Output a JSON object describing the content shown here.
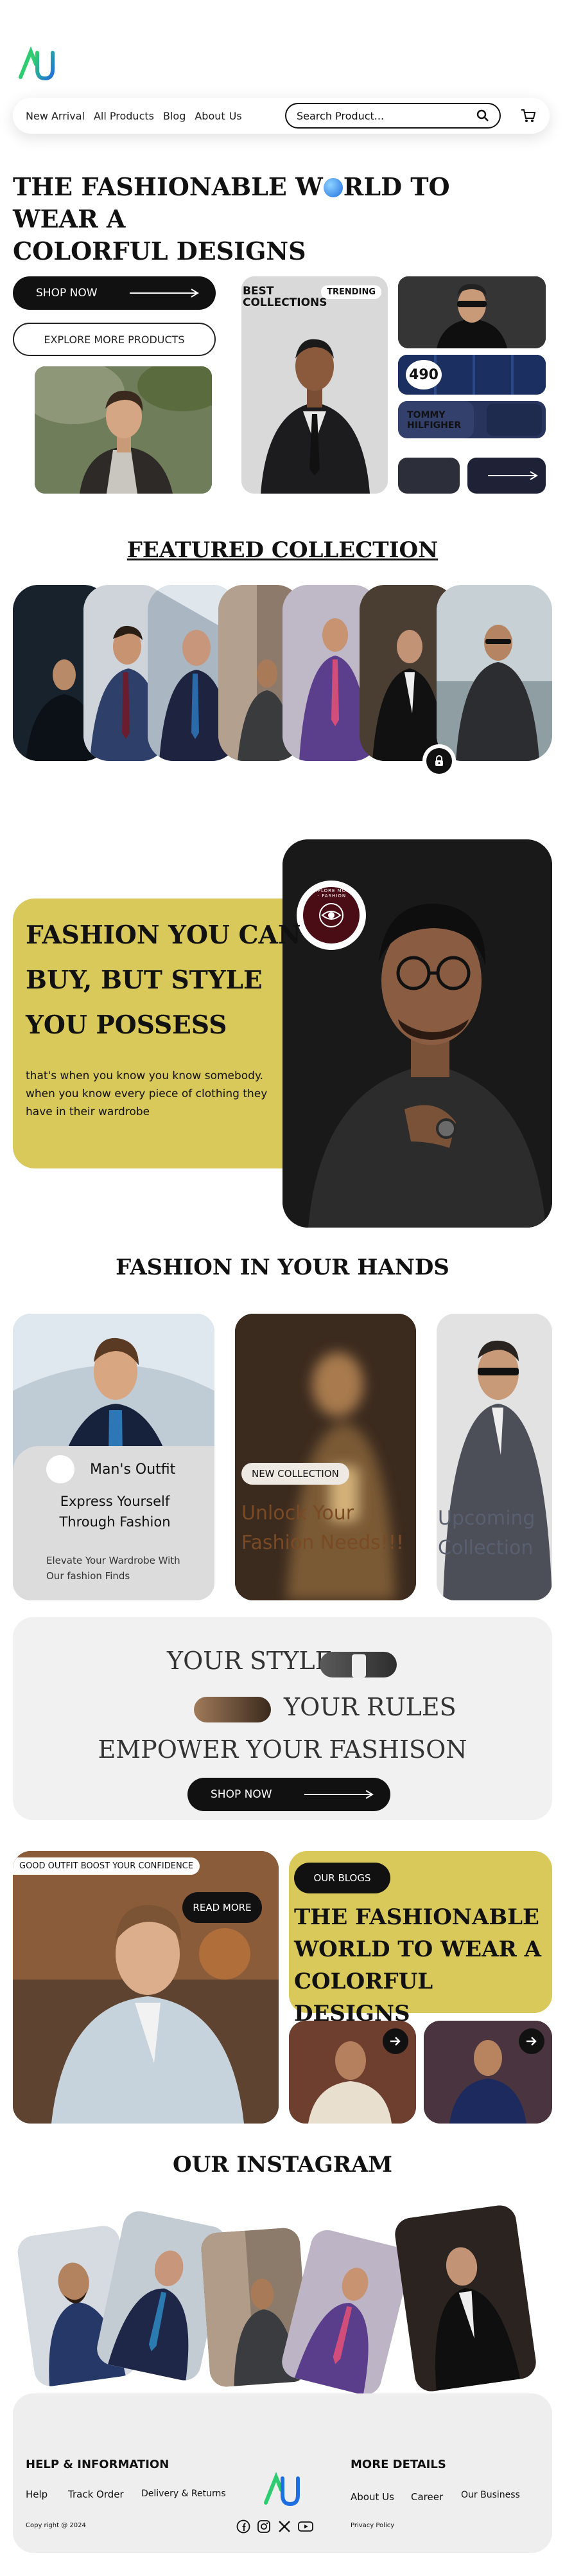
{
  "header": {
    "nav": [
      "New Arrival",
      "All Products",
      "Blog",
      "About",
      "Us"
    ],
    "search_placeholder": "Search Product..."
  },
  "hero": {
    "title_line1_a": "THE FASHIONABLE W",
    "title_line1_b": "RLD TO WEAR A",
    "title_line2": "COLORFUL DESIGNS",
    "shop_now": "SHOP NOW",
    "explore": "EXPLORE MORE PRODUCTS",
    "best_collections": "BEST COLLECTIONS",
    "trending": "TRENDING",
    "price": "490",
    "brand_tommy": "TOMMY HILFIGHER"
  },
  "featured": {
    "title": "FEATURED  COLLECTION"
  },
  "style_block": {
    "title": "FASHION YOU CAN BUY, BUT STYLE YOU POSSESS",
    "text": "that's when you know you know somebody. when you know every piece of clothing they have in their wardrobe",
    "badge": "EXPLORE MORE · FASHION"
  },
  "hands": {
    "title": "FASHION IN YOUR HANDS",
    "mans_outfit": "Man's Outfit",
    "express": "Express Yourself Through Fashion",
    "elevate": "Elevate Your Wardrobe With Our fashion Finds",
    "new_collection": "NEW COLLECTION",
    "unlock": "Unlock Your Fashion Needs!!!",
    "upcoming": "Upcoming Collection"
  },
  "rules": {
    "line1": "YOUR STYLE",
    "line2": "YOUR RULES",
    "line3": "EMPOWER YOUR FASHISON",
    "shop_now": "SHOP NOW"
  },
  "blog": {
    "good_outfit": "GOOD OUTFIT BOOST YOUR CONFIDENCE",
    "read_more": "READ MORE",
    "our_blogs": "OUR BLOGS",
    "title": "THE FASHIONABLE WORLD TO WEAR A COLORFUL DESIGNS"
  },
  "instagram": {
    "title": "OUR INSTAGRAM"
  },
  "footer": {
    "help_title": "HELP & INFORMATION",
    "help_links": [
      "Help",
      "Track Order",
      "Delivery & Returns"
    ],
    "copyright": "Copy right @ 2024",
    "more_title": "MORE DETAILS",
    "more_links": [
      "About Us",
      "Career",
      "Our Business"
    ],
    "privacy": "Privacy Policy"
  },
  "colors": {
    "accent_yellow": "#d9c95a",
    "dark": "#111111",
    "logo_green": "#2ecc71",
    "logo_blue": "#1e6fe0"
  }
}
